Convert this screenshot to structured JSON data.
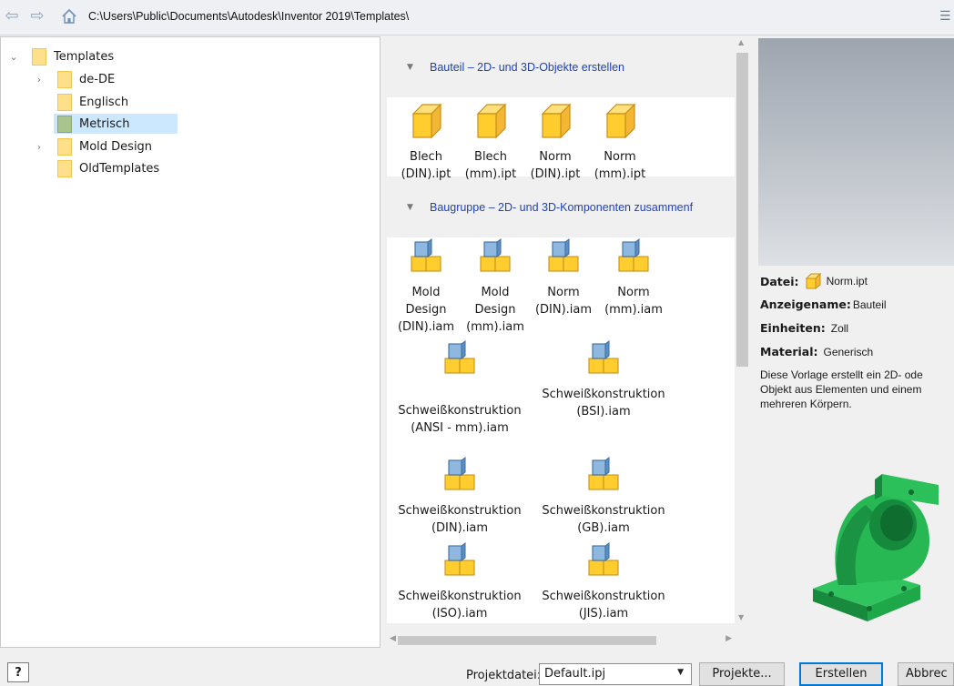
{
  "pathbar": {
    "back_icon": "arrow-left-icon",
    "forward_icon": "arrow-right-icon",
    "home_icon": "home-icon",
    "path": "C:\\Users\\Public\\Documents\\Autodesk\\Inventor 2019\\Templates\\"
  },
  "tree": {
    "items": [
      {
        "label": "Templates",
        "arrow": "⌄",
        "level": 0
      },
      {
        "label": "de-DE",
        "arrow": "›",
        "level": 1
      },
      {
        "label": "Englisch",
        "arrow": "",
        "level": 1
      },
      {
        "label": "Metrisch",
        "arrow": "",
        "level": 1,
        "selected": true
      },
      {
        "label": "Mold Design",
        "arrow": "›",
        "level": 1
      },
      {
        "label": "OldTemplates",
        "arrow": "",
        "level": 1
      }
    ]
  },
  "sections": {
    "part": {
      "title": "Bauteil – 2D- und 3D-Objekte erstellen",
      "toggle_icon": "triangle-down-icon"
    },
    "assembly": {
      "title": "Baugruppe – 2D- und 3D-Komponenten zusammenf",
      "toggle_icon": "triangle-down-icon"
    }
  },
  "part_templates": [
    {
      "label": "Blech\n(DIN).ipt"
    },
    {
      "label": "Blech\n(mm).ipt"
    },
    {
      "label": "Norm\n(DIN).ipt"
    },
    {
      "label": "Norm\n(mm).ipt"
    }
  ],
  "assembly_templates": [
    {
      "label": "Mold\nDesign\n(DIN).iam"
    },
    {
      "label": "Mold\nDesign\n(mm).iam"
    },
    {
      "label": "Norm\n(DIN).iam"
    },
    {
      "label": "Norm\n(mm).iam"
    },
    {
      "label": "Schweißkonstruktion\n(ANSI - mm).iam"
    },
    {
      "label": "Schweißkonstruktion\n(BSI).iam"
    },
    {
      "label": "Schweißkonstruktion\n(DIN).iam"
    },
    {
      "label": "Schweißkonstruktion\n(GB).iam"
    },
    {
      "label": "Schweißkonstruktion\n(ISO).iam"
    },
    {
      "label": "Schweißkonstruktion\n(JIS).iam"
    }
  ],
  "info": {
    "file_label": "Datei:",
    "file_value": "Norm.ipt",
    "display_label": "Anzeigename:",
    "display_value": "Bauteil",
    "units_label": "Einheiten:",
    "units_value": "Zoll",
    "material_label": "Material:",
    "material_value": "Generisch",
    "description": "Diese Vorlage erstellt ein 2D- ode\nObjekt aus Elementen und einem\nmehreren Körpern."
  },
  "bottom": {
    "help_label": "?",
    "project_label": "Projektdatei:",
    "project_value": "Default.ipj",
    "projects_button": "Projekte...",
    "create_button": "Erstellen",
    "cancel_button": "Abbrec"
  },
  "colors": {
    "folder": "#ffe08a",
    "section_title": "#1f43b5",
    "preview_model": "#1fa84a",
    "selection": "#cce8ff"
  }
}
